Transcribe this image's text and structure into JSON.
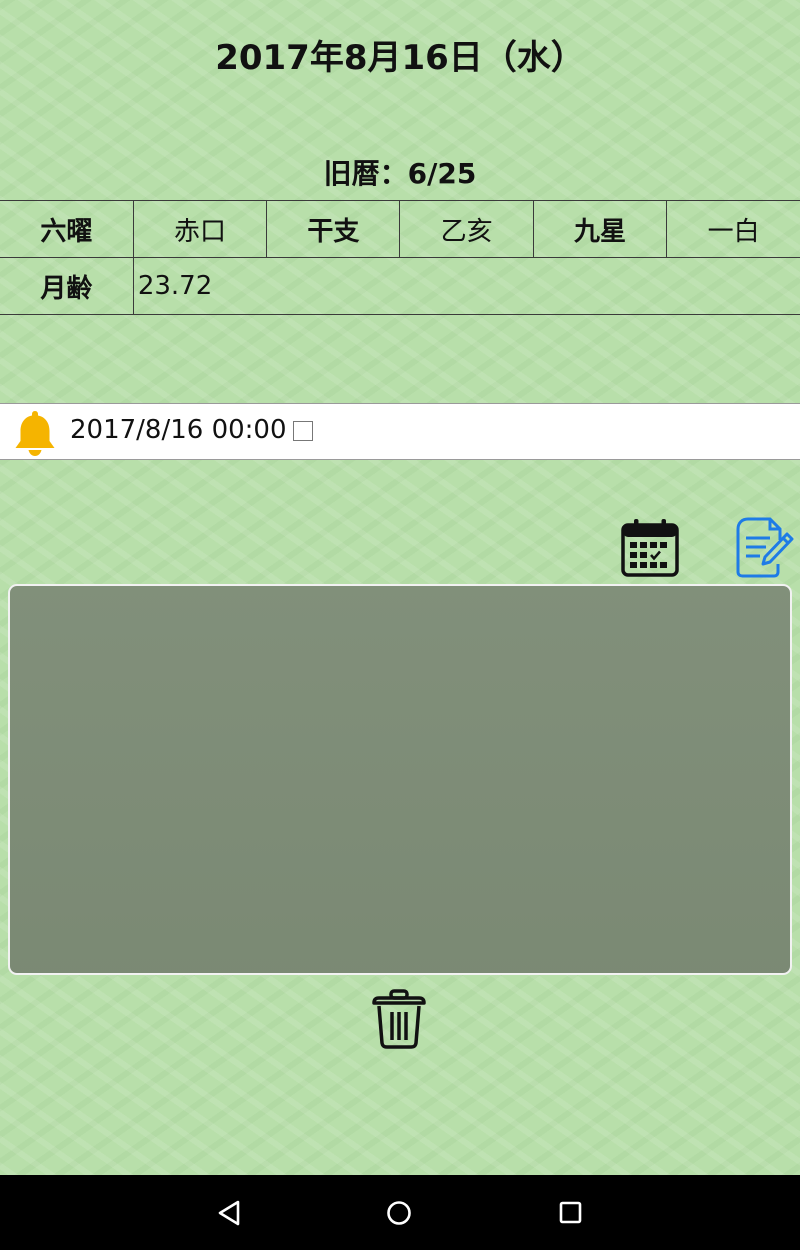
{
  "header": {
    "date": "2017年8月16日（水）",
    "lunar_date": "旧暦：6/25"
  },
  "info_table": {
    "rokuyo_label": "六曜",
    "rokuyo_value": "赤口",
    "kanshi_label": "干支",
    "kanshi_value": "乙亥",
    "kyusei_label": "九星",
    "kyusei_value": "一白",
    "moon_age_label": "月齢",
    "moon_age_value": "23.72"
  },
  "alarm": {
    "datetime": "2017/8/16 00:00",
    "enabled": false,
    "icon": "bell-icon",
    "icon_color": "#f5b400"
  },
  "toolbar": {
    "calendar_icon": "calendar-icon",
    "edit_icon": "edit-icon",
    "edit_icon_color": "#1e7be6"
  },
  "memo": {
    "text": ""
  },
  "footer": {
    "delete_icon": "trash-icon"
  },
  "system_nav": {
    "back_icon": "back-icon",
    "home_icon": "home-icon",
    "recents_icon": "recents-icon"
  }
}
